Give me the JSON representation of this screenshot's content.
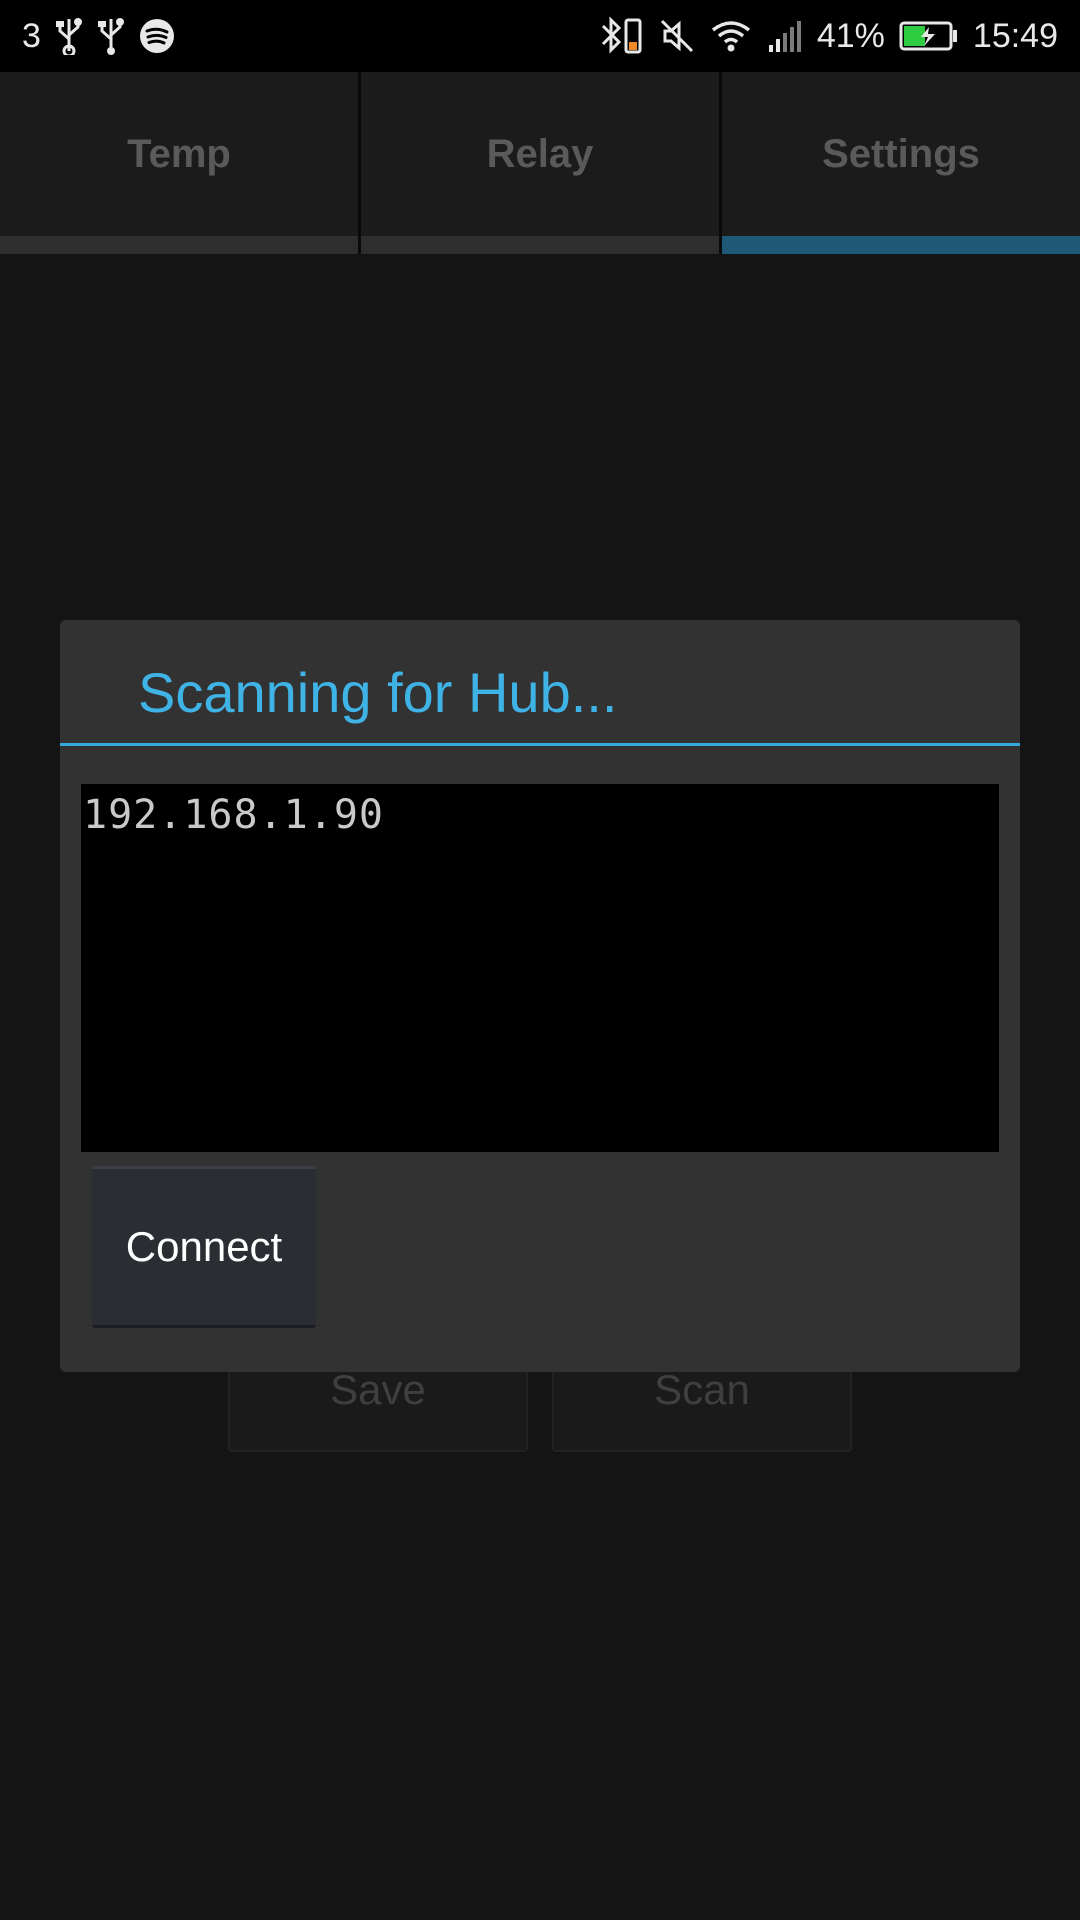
{
  "status_bar": {
    "carrier": "3",
    "battery_percent": "41%",
    "time": "15:49",
    "left_icons": [
      "usb-icon",
      "usb-icon",
      "spotify-icon"
    ],
    "right_icons": [
      "bluetooth-battery-icon",
      "mute-icon",
      "wifi-icon",
      "signal-icon",
      "battery-charging-icon"
    ]
  },
  "tabs": [
    {
      "label": "Temp",
      "active": false
    },
    {
      "label": "Relay",
      "active": false
    },
    {
      "label": "Settings",
      "active": true
    }
  ],
  "background_buttons": {
    "save_label": "Save",
    "scan_label": "Scan"
  },
  "dialog": {
    "title": "Scanning for Hub...",
    "terminal_text": "192.168.1.90",
    "connect_label": "Connect"
  },
  "colors": {
    "accent": "#3fb3e6",
    "active_tab_indicator": "#1e5a78",
    "background": "#141414",
    "dialog_background": "#323232"
  }
}
